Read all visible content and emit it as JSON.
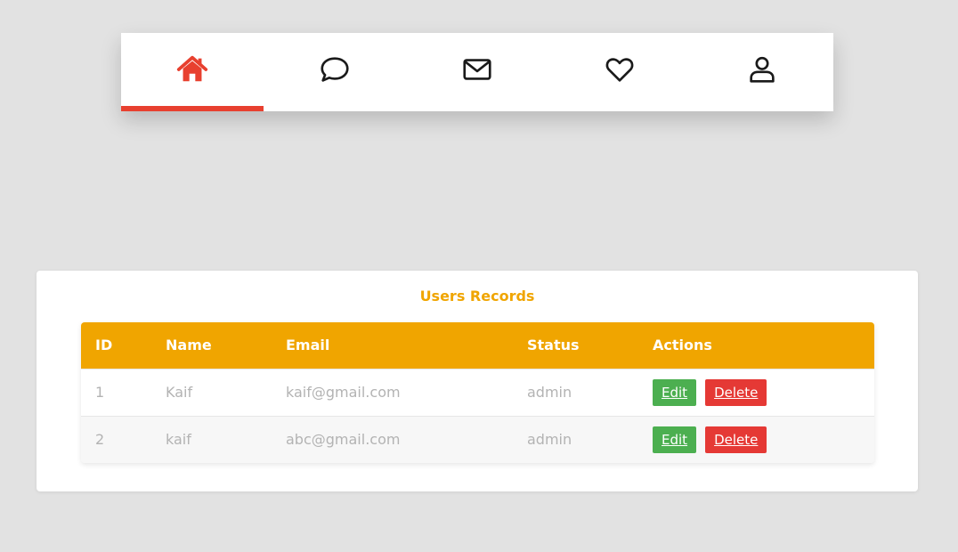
{
  "nav": {
    "items": [
      {
        "icon": "home-icon",
        "active": true
      },
      {
        "icon": "chat-icon",
        "active": false
      },
      {
        "icon": "mail-icon",
        "active": false
      },
      {
        "icon": "heart-icon",
        "active": false
      },
      {
        "icon": "user-icon",
        "active": false
      }
    ]
  },
  "colors": {
    "accent": "#e8402f",
    "header": "#f0a500",
    "edit": "#4caf50",
    "delete": "#e53935"
  },
  "records": {
    "title": "Users Records",
    "columns": {
      "id": "ID",
      "name": "Name",
      "email": "Email",
      "status": "Status",
      "actions": "Actions"
    },
    "rows": [
      {
        "id": "1",
        "name": "Kaif",
        "email": "kaif@gmail.com",
        "status": "admin",
        "edit": "Edit",
        "delete": "Delete"
      },
      {
        "id": "2",
        "name": "kaif",
        "email": "abc@gmail.com",
        "status": "admin",
        "edit": "Edit",
        "delete": "Delete"
      }
    ]
  }
}
